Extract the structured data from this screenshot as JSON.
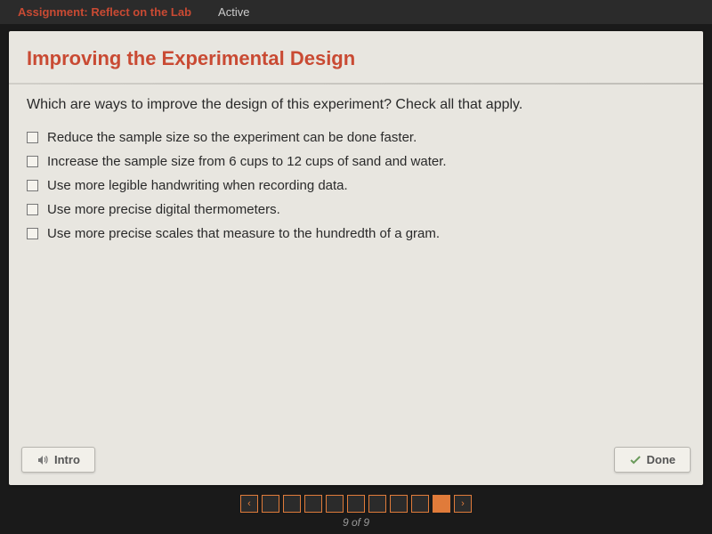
{
  "topbar": {
    "assignment_label": "Assignment: Reflect on the Lab",
    "status": "Active"
  },
  "card": {
    "title": "Improving the Experimental Design",
    "question": "Which are ways to improve the design of this experiment? Check all that apply.",
    "options": [
      "Reduce the sample size so the experiment can be done faster.",
      "Increase the sample size from 6 cups to 12 cups of sand and water.",
      "Use more legible handwriting when recording data.",
      "Use more precise digital thermometers.",
      "Use more precise scales that measure to the hundredth of a gram."
    ],
    "intro_btn": "Intro",
    "done_btn": "Done"
  },
  "footer": {
    "total_pages": 9,
    "current_page": 9,
    "counter": "9 of 9"
  }
}
